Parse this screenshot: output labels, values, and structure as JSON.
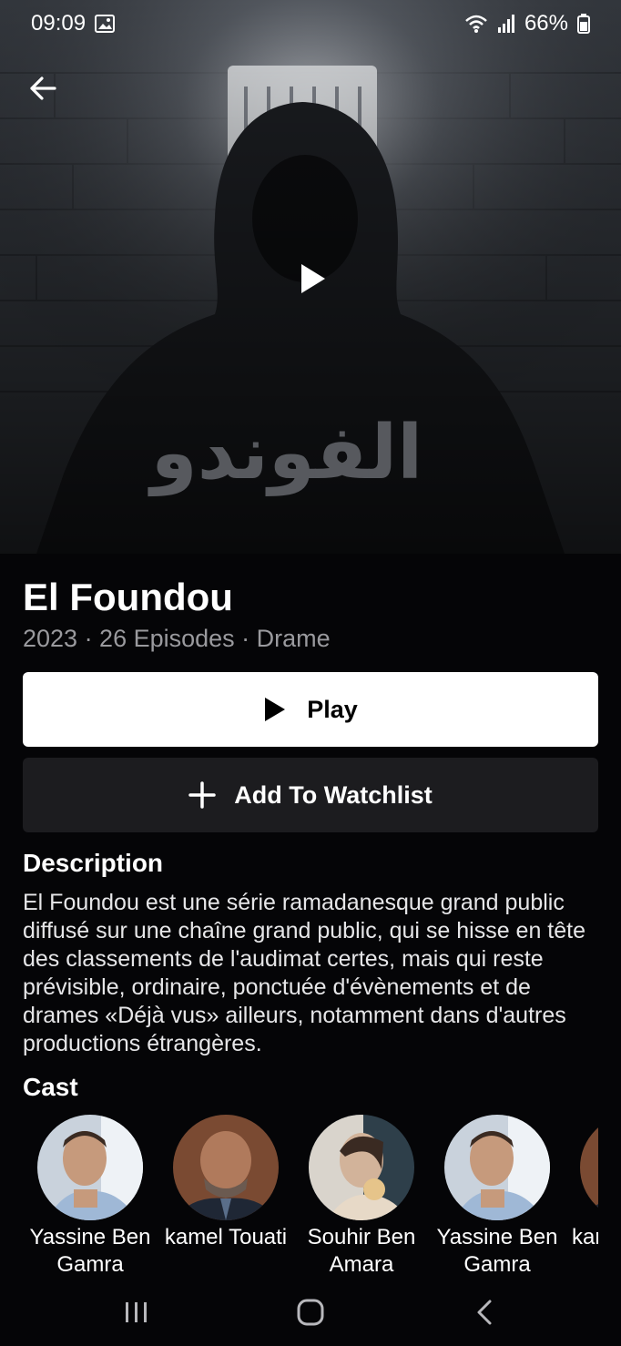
{
  "status_bar": {
    "time": "09:09",
    "battery": "66%"
  },
  "hero": {
    "poster_text": "الفوندو"
  },
  "show": {
    "title": "El Foundou",
    "meta": "2023 · 26 Episodes · Drame"
  },
  "actions": {
    "play_label": "Play",
    "watchlist_label": "Add To Watchlist"
  },
  "description": {
    "heading": "Description",
    "text": "El Foundou est une série ramadanesque grand public diffusé sur une chaîne grand public, qui se hisse en tête des classements de l'audimat certes, mais qui reste prévisible, ordinaire, ponctuée d'évènements et de drames «Déjà vus» ailleurs, notamment dans d'autres productions étrangères."
  },
  "cast": {
    "heading": "Cast",
    "members": [
      {
        "name": "Yassine Ben Gamra"
      },
      {
        "name": "kamel Touati"
      },
      {
        "name": "Souhir Ben Amara"
      },
      {
        "name": "Yassine Ben Gamra"
      },
      {
        "name": "kar"
      }
    ]
  },
  "colors": {
    "background": "#050507",
    "button_primary": "#ffffff",
    "button_secondary": "#1c1c1f",
    "meta_text": "#9a9a9e"
  }
}
